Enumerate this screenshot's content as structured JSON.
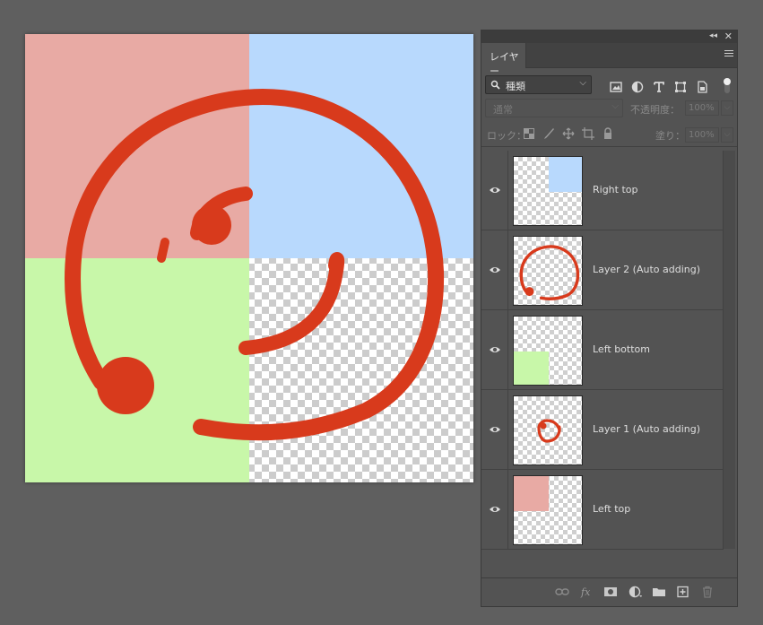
{
  "canvas": {
    "quadrant_colors": {
      "left_top": "#e8aaa4",
      "right_top": "#b8d9fd",
      "left_bottom": "#c8f7a9"
    },
    "stroke_color": "#d83a1c"
  },
  "panel": {
    "tab_label": "レイヤー",
    "filter": {
      "selected": "種類"
    },
    "blend_mode": "通常",
    "opacity_label": "不透明度：",
    "opacity_value": "100%",
    "lock_label": "ロック：",
    "fill_label": "塗り：",
    "fill_value": "100%",
    "layers": [
      {
        "name": "Right top",
        "visible": true
      },
      {
        "name": "Layer 2 (Auto adding)",
        "visible": true
      },
      {
        "name": "Left bottom",
        "visible": true
      },
      {
        "name": "Layer 1 (Auto adding)",
        "visible": true
      },
      {
        "name": "Left top",
        "visible": true
      }
    ],
    "bottom_icons": [
      "link-icon",
      "fx-icon",
      "mask-icon",
      "adjustment-icon",
      "folder-icon",
      "new-layer-icon",
      "trash-icon"
    ]
  }
}
